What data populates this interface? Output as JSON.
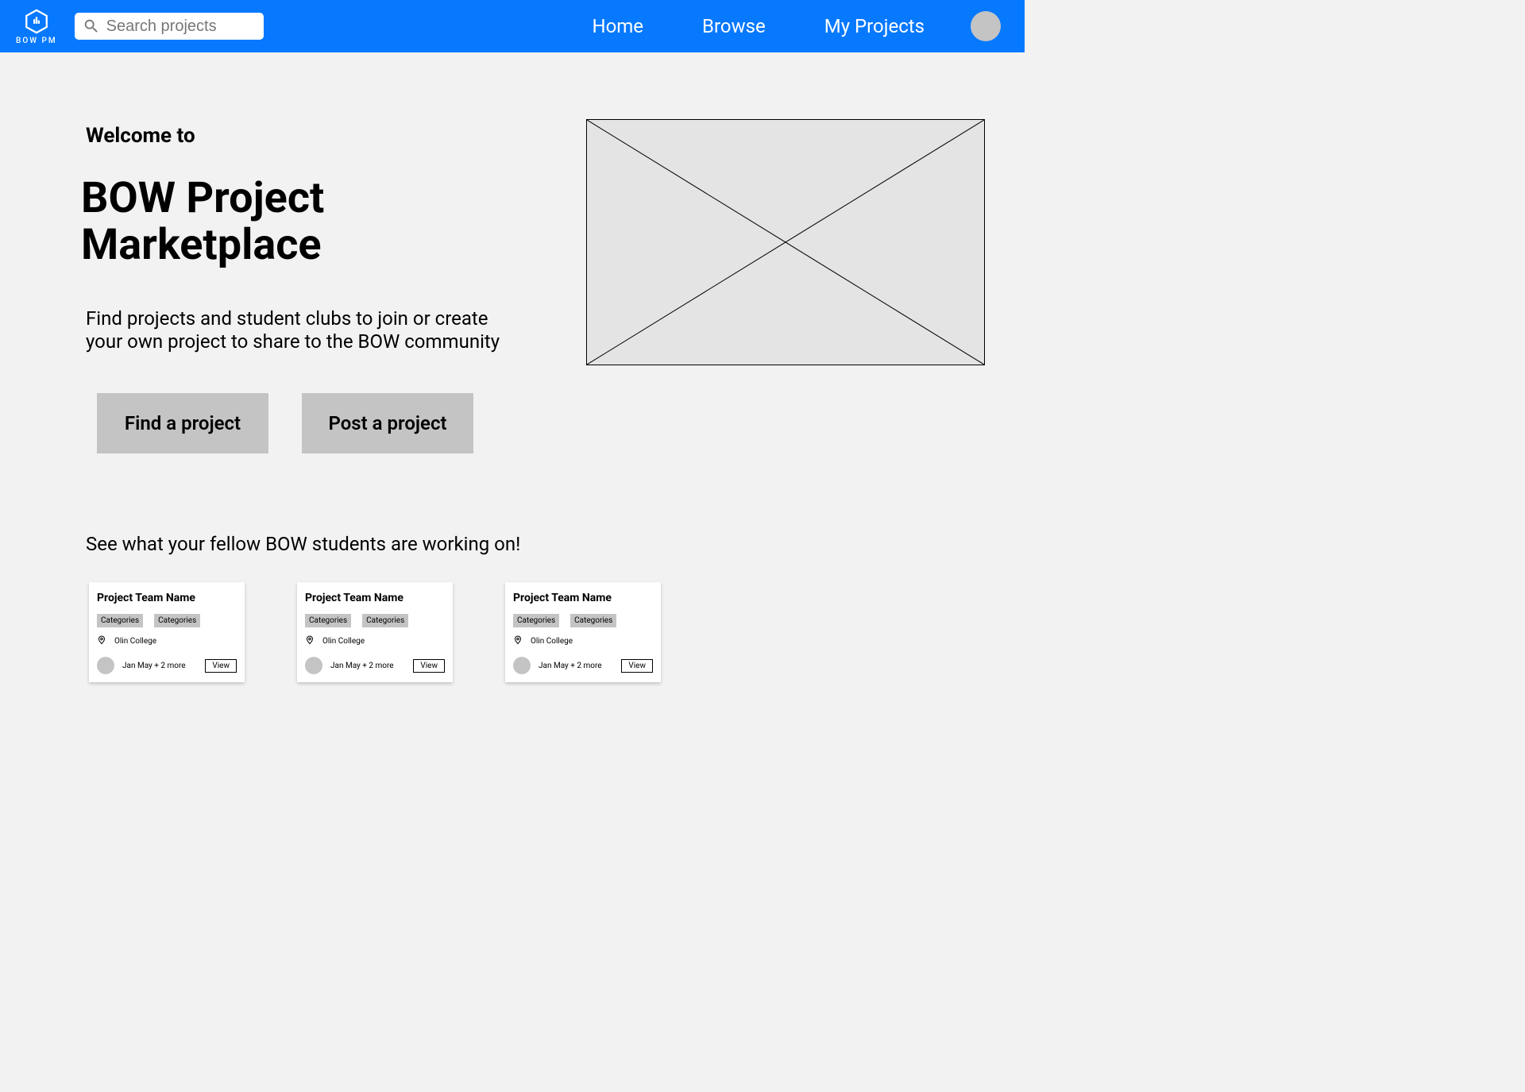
{
  "header": {
    "logo_text": "BOW PM",
    "search_placeholder": "Search projects",
    "nav": {
      "home": "Home",
      "browse": "Browse",
      "my_projects": "My Projects"
    }
  },
  "hero": {
    "welcome": "Welcome to",
    "title": "BOW Project Marketplace",
    "description": "Find projects and student clubs to join or create your own project to share to the BOW community",
    "find_btn": "Find a project",
    "post_btn": "Post a project"
  },
  "section_heading": "See what your fellow BOW students are working on!",
  "cards": [
    {
      "title": "Project Team Name",
      "tags": [
        "Categories",
        "Categories"
      ],
      "location": "Olin College",
      "members": "Jan May + 2 more",
      "view": "View"
    },
    {
      "title": "Project Team Name",
      "tags": [
        "Categories",
        "Categories"
      ],
      "location": "Olin College",
      "members": "Jan May + 2 more",
      "view": "View"
    },
    {
      "title": "Project Team Name",
      "tags": [
        "Categories",
        "Categories"
      ],
      "location": "Olin College",
      "members": "Jan May + 2 more",
      "view": "View"
    }
  ]
}
